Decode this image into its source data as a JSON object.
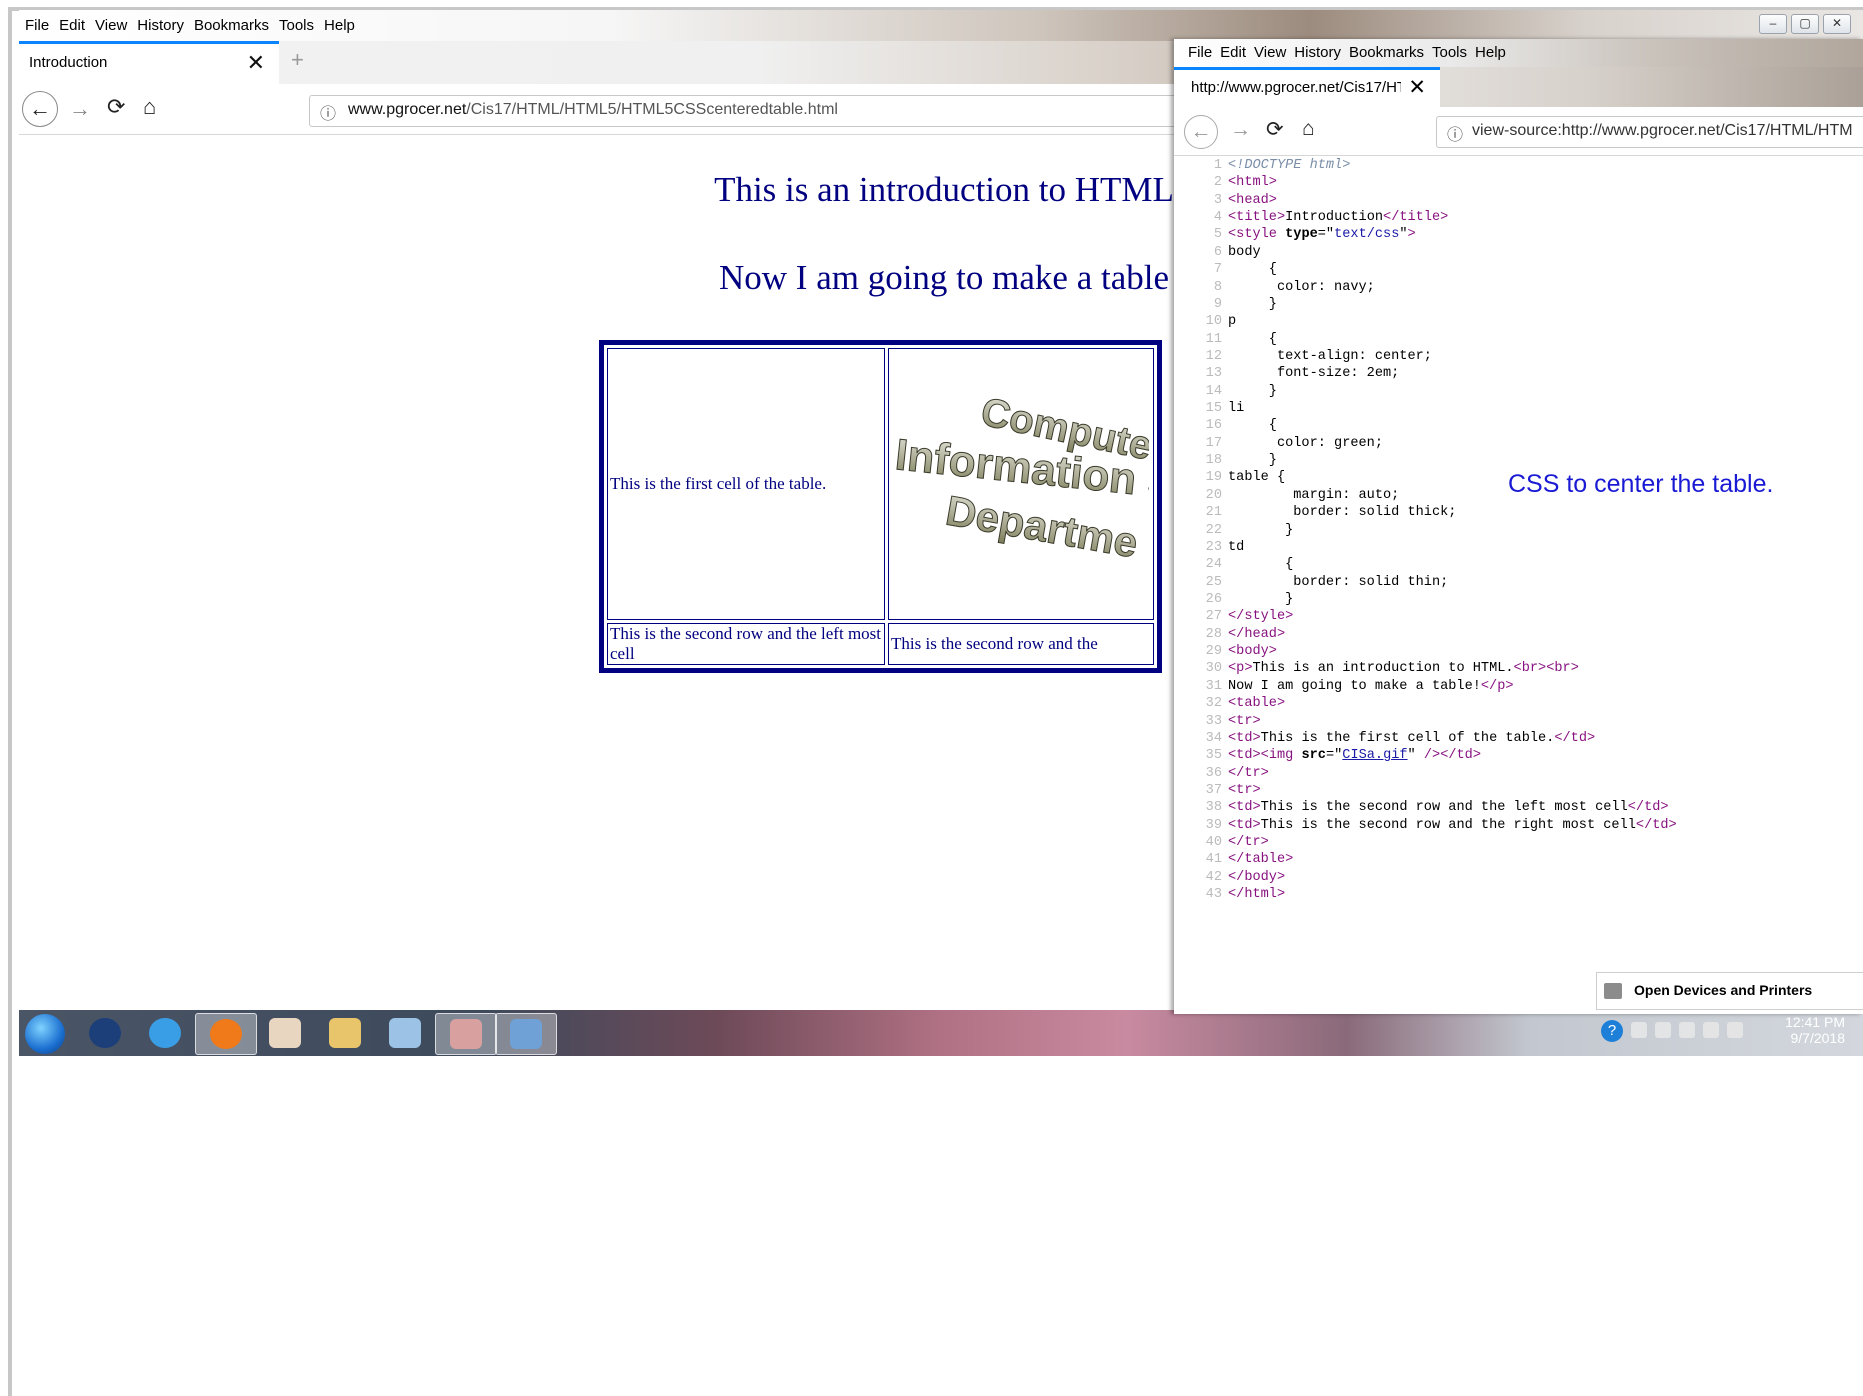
{
  "main_browser": {
    "menu": [
      "File",
      "Edit",
      "View",
      "History",
      "Bookmarks",
      "Tools",
      "Help"
    ],
    "tab_title": "Introduction",
    "url_host": "www.pgrocer.net",
    "url_path": "/Cis17/HTML/HTML5/HTML5CSScenteredtable.html",
    "page": {
      "para1": "This is an introduction to HTML",
      "para2": "Now I am going to make a table",
      "table": {
        "cell1": "This is the first cell of the table.",
        "row2_left": "This is the second row and the left most cell",
        "row2_right": "This is the second row and the"
      }
    }
  },
  "source_browser": {
    "menu": [
      "File",
      "Edit",
      "View",
      "History",
      "Bookmarks",
      "Tools",
      "Help"
    ],
    "tab_title": "http://www.pgrocer.net/Cis17/HTM",
    "url": "view-source:http://www.pgrocer.net/Cis17/HTML/HTM",
    "code_lines": [
      "<!DOCTYPE html>",
      "<html>",
      "<head>",
      "<title>Introduction</title>",
      "<style type=\"text/css\">",
      "body",
      "     {",
      "      color: navy;",
      "     }",
      "p",
      "     {",
      "      text-align: center;",
      "      font-size: 2em;",
      "     }",
      "li",
      "     {",
      "      color: green;",
      "     }",
      "table {",
      "        margin: auto;",
      "        border: solid thick;",
      "       }",
      "td",
      "       {",
      "        border: solid thin;",
      "       }",
      "</style>",
      "</head>",
      "<body>",
      "<p>This is an introduction to HTML.<br><br>",
      "Now I am going to make a table!</p>",
      "<table>",
      "<tr>",
      "<td>This is the first cell of the table.</td>",
      "<td><img src=\"CISa.gif\" /></td>",
      "</tr>",
      "<tr>",
      "<td>This is the second row and the left most cell</td>",
      "<td>This is the second row and the right most cell</td>",
      "</tr>",
      "</table>",
      "</body>",
      "</html>"
    ],
    "annotation": "CSS to center the table.",
    "tooltip": "Open Devices and Printers"
  },
  "taskbar": {
    "time": "12:41 PM",
    "date": "9/7/2018"
  },
  "logo_text": [
    "Computer",
    "Information Sy",
    "Departme"
  ]
}
